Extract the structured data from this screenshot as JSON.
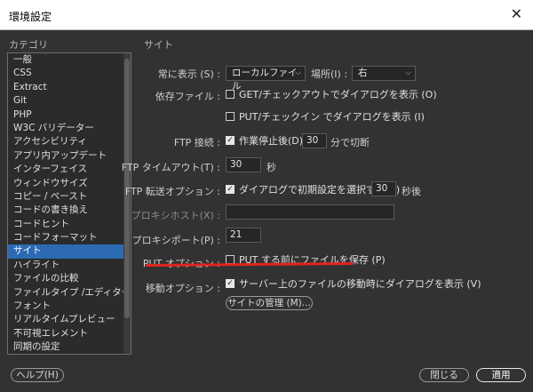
{
  "window": {
    "title": "環境設定",
    "close_glyph": "✕"
  },
  "sidebar": {
    "heading": "カテゴリ",
    "items": [
      {
        "label": "一般"
      },
      {
        "label": "CSS"
      },
      {
        "label": "Extract"
      },
      {
        "label": "Git"
      },
      {
        "label": "PHP"
      },
      {
        "label": "W3C バリデーター"
      },
      {
        "label": "アクセシビリティ"
      },
      {
        "label": "アプリ内アップデート"
      },
      {
        "label": "インターフェイス"
      },
      {
        "label": "ウィンドウサイズ"
      },
      {
        "label": "コピー / ペースト"
      },
      {
        "label": "コードの書き換え"
      },
      {
        "label": "コードヒント"
      },
      {
        "label": "コードフォーマット"
      },
      {
        "label": "サイト"
      },
      {
        "label": "ハイライト"
      },
      {
        "label": "ファイルの比較"
      },
      {
        "label": "ファイルタイプ /エディター"
      },
      {
        "label": "フォント"
      },
      {
        "label": "リアルタイムプレビュー"
      },
      {
        "label": "不可視エレメント"
      },
      {
        "label": "同期の設定"
      }
    ],
    "selected_index": 14
  },
  "site": {
    "heading": "サイト",
    "always_show": {
      "label": "常に表示 (S) :",
      "value": "ローカルファイル",
      "position_label": "場所(I) :",
      "position_value": "右"
    },
    "dependent_files": {
      "label": "依存ファイル :",
      "get_option": {
        "label": "GET/チェックアウトでダイアログを表示 (O)",
        "checked": false
      },
      "put_option": {
        "label": "PUT/チェックイン でダイアログを表示 (I)",
        "checked": false
      }
    },
    "ftp_connection": {
      "label": "FTP 接続 :",
      "option_label": "作業停止後(D)",
      "checked": true,
      "minutes": "30",
      "suffix": "分で切断"
    },
    "ftp_timeout": {
      "label": "FTP タイムアウト(T) :",
      "value": "30",
      "suffix": "秒"
    },
    "ftp_transfer": {
      "label": "FTP 転送オプション :",
      "option_label": "ダイアログで初期設定を選択する(A)",
      "checked": true,
      "value": "30",
      "suffix": "秒後"
    },
    "proxy_host": {
      "label": "プロキシホスト(X) :",
      "value": ""
    },
    "proxy_port": {
      "label": "プロキシポート(P) :",
      "value": "21"
    },
    "put_option": {
      "label": "PUT オプション :",
      "option_label": "PUT する前にファイルを保存 (P)",
      "checked": false
    },
    "move_option": {
      "label": "移動オプション :",
      "option_label": "サーバー上のファイルの移動時にダイアログを表示 (V)",
      "checked": true
    },
    "manage_sites_button": "サイトの管理 (M)..."
  },
  "footer": {
    "help_button": "ヘルプ(H)",
    "close_button": "閉じる",
    "apply_button": "適用"
  },
  "colors": {
    "background": "#323232",
    "selection": "#2c6bb3",
    "annotation_underline": "#e0241f"
  },
  "icons": {
    "dropdown": "chevron-down-icon",
    "check": "checkmark-icon",
    "close": "close-icon"
  },
  "glyphs": {
    "chevron": "⌵",
    "check": "✓"
  }
}
